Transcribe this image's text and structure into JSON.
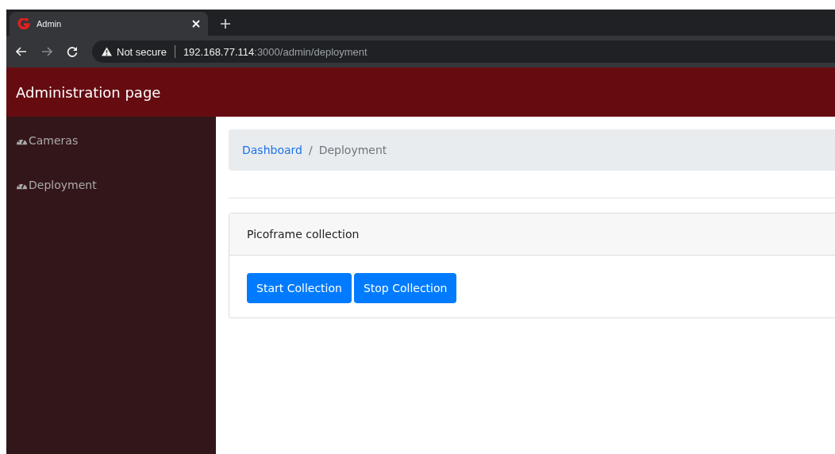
{
  "browser": {
    "tab_title": "Admin",
    "url_warning": "Not secure",
    "url_host": "192.168.77.114",
    "url_rest": ":3000/admin/deployment"
  },
  "header": {
    "title": "Administration page"
  },
  "sidebar": {
    "items": [
      {
        "label": "Cameras"
      },
      {
        "label": "Deployment"
      }
    ]
  },
  "breadcrumb": {
    "separator": "/",
    "items": [
      {
        "label": "Dashboard",
        "kind": "link"
      },
      {
        "label": "Deployment",
        "kind": "current"
      }
    ]
  },
  "card": {
    "title": "Picoframe collection",
    "buttons": [
      "Start Collection",
      "Stop Collection"
    ]
  }
}
